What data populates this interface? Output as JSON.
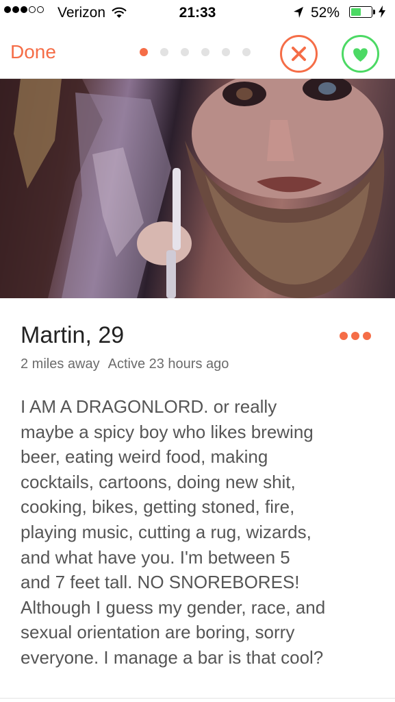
{
  "status_bar": {
    "carrier": "Verizon",
    "time": "21:33",
    "battery_percent": "52%",
    "battery_level": 0.52,
    "signal_bars_filled": 3,
    "signal_bars_total": 5
  },
  "nav": {
    "done_label": "Done",
    "photo_pages_total": 6,
    "photo_page_active": 1,
    "nope_icon": "close-icon",
    "like_icon": "heart-icon"
  },
  "profile": {
    "name": "Martin",
    "age": "29",
    "distance": "2 miles away",
    "last_active": "Active 23 hours ago",
    "bio": "I AM A DRAGONLORD.  or really\nmaybe a spicy boy who likes brewing\nbeer, eating weird food, making\ncocktails, cartoons, doing new shit,\ncooking, bikes, getting stoned, fire,\nplaying music, cutting a rug, wizards,\nand what have you.   I'm between 5\nand 7 feet tall. NO SNOREBORES!\nAlthough I guess my gender, race, and\nsexual orientation are boring, sorry\neveryone. I manage a bar is that cool?"
  },
  "colors": {
    "accent": "#f56d47",
    "like": "#4cd964",
    "text": "#555555"
  }
}
